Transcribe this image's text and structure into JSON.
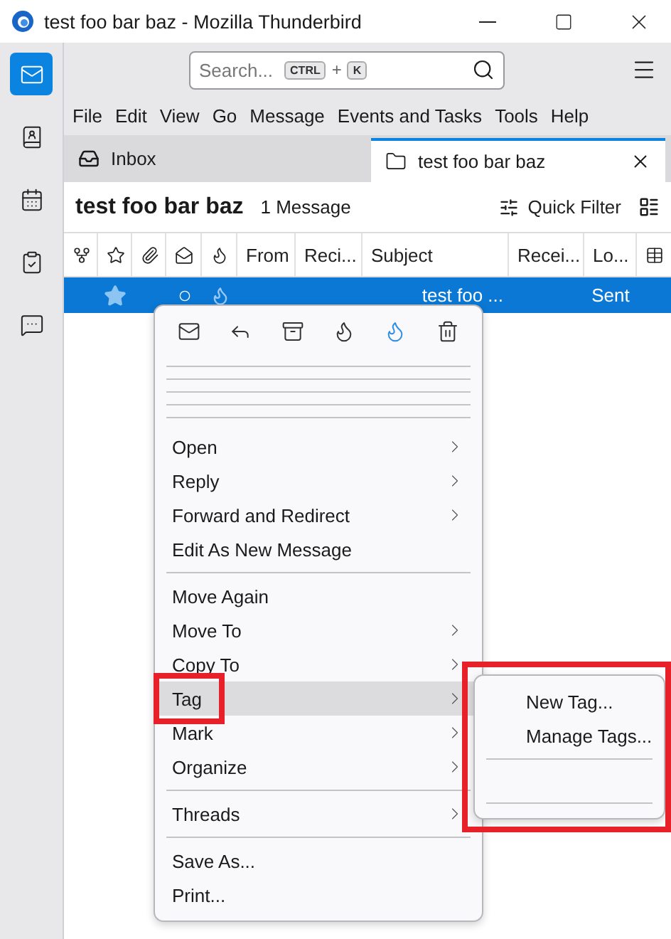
{
  "window": {
    "title": "test foo bar baz - Mozilla Thunderbird"
  },
  "spaces": [
    {
      "kind": "mail",
      "selected": true
    },
    {
      "kind": "contacts",
      "selected": false
    },
    {
      "kind": "calendar",
      "selected": false
    },
    {
      "kind": "tasks",
      "selected": false
    },
    {
      "kind": "chat",
      "selected": false
    }
  ],
  "search": {
    "placeholder": "Search...",
    "keys": [
      "CTRL",
      "K"
    ],
    "joiner": "+"
  },
  "menubar": [
    {
      "label": "File"
    },
    {
      "label": "Edit"
    },
    {
      "label": "View"
    },
    {
      "label": "Go"
    },
    {
      "label": "Message"
    },
    {
      "label": "Events and Tasks"
    },
    {
      "label": "Tools"
    },
    {
      "label": "Help"
    }
  ],
  "tabs": [
    {
      "label": "Inbox",
      "kind": "inbox",
      "selected": false
    },
    {
      "label": "test foo bar baz",
      "kind": "folder",
      "selected": true,
      "closable": true
    }
  ],
  "folder_header": {
    "title": "test foo bar baz",
    "count": "1 Message",
    "quick_filter": "Quick Filter"
  },
  "columns": [
    {
      "kind": "thread"
    },
    {
      "kind": "star"
    },
    {
      "kind": "attachment"
    },
    {
      "kind": "read"
    },
    {
      "kind": "junk"
    },
    {
      "kind": "text",
      "label": "From"
    },
    {
      "kind": "text",
      "label": "Reci..."
    },
    {
      "kind": "text",
      "label": "Subject"
    },
    {
      "kind": "text",
      "label": "Recei..."
    },
    {
      "kind": "text",
      "label": "Lo..."
    },
    {
      "kind": "picker"
    }
  ],
  "rows": [
    {
      "selected": true,
      "starred": true,
      "subject": "test foo ...",
      "location": "Sent"
    }
  ],
  "context_menu": {
    "toolbar": [
      {
        "kind": "mail",
        "active": false
      },
      {
        "kind": "reply",
        "active": false
      },
      {
        "kind": "archive",
        "active": false
      },
      {
        "kind": "junk",
        "active": false
      },
      {
        "kind": "notjunk",
        "active": true
      },
      {
        "kind": "delete",
        "active": false
      }
    ],
    "items": [
      {
        "kind": "item",
        "label": "Open",
        "submenu": true,
        "hovered": false
      },
      {
        "kind": "item",
        "label": "Reply",
        "submenu": true,
        "hovered": false
      },
      {
        "kind": "item",
        "label": "Forward and Redirect",
        "submenu": true,
        "hovered": false
      },
      {
        "kind": "item",
        "label": "Edit As New Message",
        "submenu": false,
        "hovered": false
      },
      {
        "kind": "separator"
      },
      {
        "kind": "item",
        "label": "Move Again",
        "submenu": false,
        "hovered": false
      },
      {
        "kind": "item",
        "label": "Move To",
        "submenu": true,
        "hovered": false
      },
      {
        "kind": "item",
        "label": "Copy To",
        "submenu": true,
        "hovered": false
      },
      {
        "kind": "item",
        "label": "Tag",
        "submenu": true,
        "hovered": true,
        "highlighted": true
      },
      {
        "kind": "item",
        "label": "Mark",
        "submenu": true,
        "hovered": false
      },
      {
        "kind": "item",
        "label": "Organize",
        "submenu": true,
        "hovered": false
      },
      {
        "kind": "separator"
      },
      {
        "kind": "item",
        "label": "Threads",
        "submenu": true,
        "hovered": false
      },
      {
        "kind": "separator"
      },
      {
        "kind": "item",
        "label": "Save As...",
        "submenu": false,
        "hovered": false
      },
      {
        "kind": "item",
        "label": "Print...",
        "submenu": false,
        "hovered": false
      }
    ]
  },
  "tag_submenu": {
    "highlighted": true,
    "items": [
      {
        "kind": "item",
        "label": "New Tag..."
      },
      {
        "kind": "item",
        "label": "Manage Tags..."
      },
      {
        "kind": "separator"
      },
      {
        "kind": "spacer"
      },
      {
        "kind": "separator"
      }
    ]
  }
}
